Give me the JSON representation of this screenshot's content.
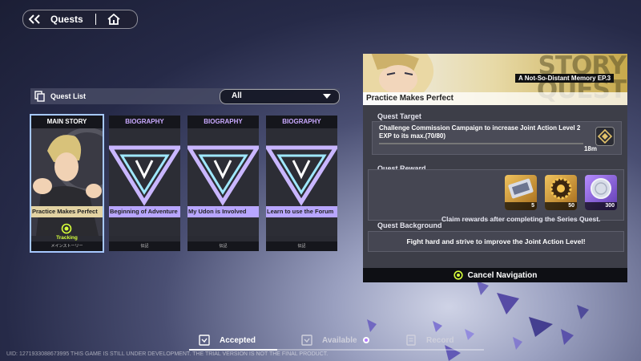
{
  "nav": {
    "title": "Quests"
  },
  "quest_list": {
    "label": "Quest List",
    "filter_value": "All",
    "cards": [
      {
        "category": "MAIN STORY",
        "title": "Practice Makes Perfect",
        "status": "Tracking",
        "footer": "メインストーリー"
      },
      {
        "category": "BIOGRAPHY",
        "title": "Beginning of Adventure",
        "footer": "伝記"
      },
      {
        "category": "BIOGRAPHY",
        "title": "My Udon is Involved",
        "footer": "伝記"
      },
      {
        "category": "BIOGRAPHY",
        "title": "Learn to use the Forum",
        "footer": "伝記"
      }
    ]
  },
  "detail": {
    "banner_word_1": "STORY",
    "banner_word_2": "QUEST",
    "episode": "A Not-So-Distant Memory  EP.3",
    "quest_name": "Practice Makes Perfect",
    "target_label": "Quest Target",
    "target_text": "Challenge Commission Campaign to increase Joint Action Level 2 EXP to its max.(70/80)",
    "target_distance": "18m",
    "reward_label": "Quest Reward",
    "rewards": [
      {
        "icon": "ticket-icon",
        "qty": "5"
      },
      {
        "icon": "gear-coin-icon",
        "qty": "50"
      },
      {
        "icon": "silver-coin-icon",
        "qty": "300"
      }
    ],
    "reward_note": "Claim rewards after completing the Series Quest.",
    "background_label": "Quest Background",
    "background_text": "Fight hard and strive to improve the Joint Action Level!",
    "cancel_label": "Cancel Navigation"
  },
  "tabs": [
    {
      "label": "Accepted"
    },
    {
      "label": "Available"
    },
    {
      "label": "Record"
    }
  ],
  "footer_text": "UID: 1271933088673995   THIS GAME IS STILL UNDER DEVELOPMENT. THE TRIAL VERSION IS NOT THE FINAL PRODUCT.",
  "colors": {
    "tracking": "#d6ff3a",
    "selected_outline": "#a6c8ff",
    "biography": "#c9a9ff"
  }
}
